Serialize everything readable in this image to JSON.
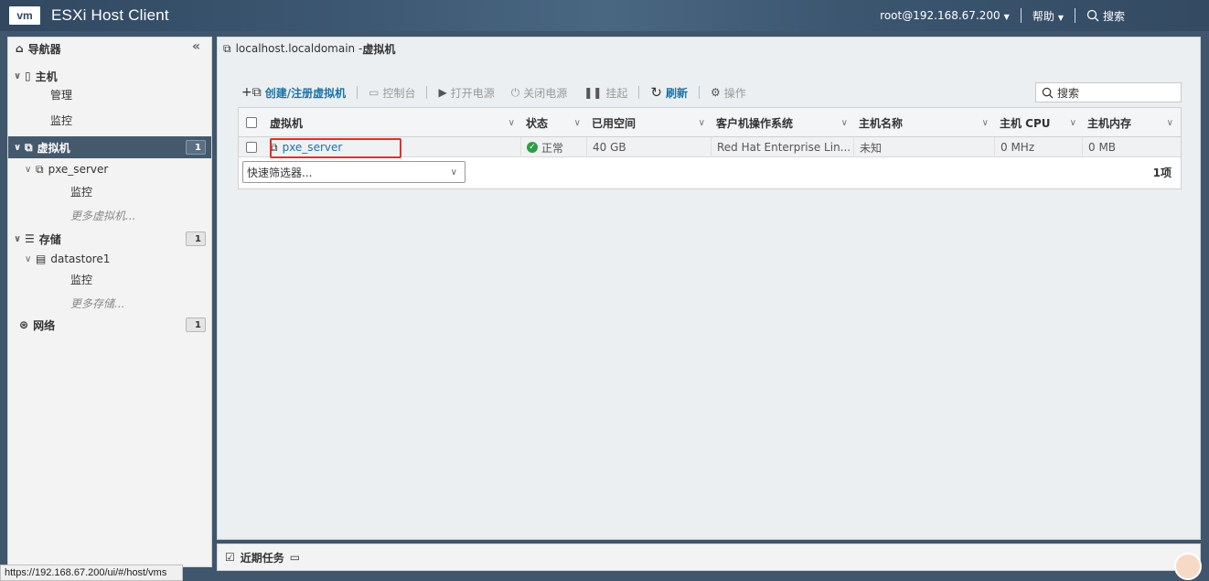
{
  "header": {
    "logo": "vm",
    "title": "ESXi Host Client",
    "user": "root@192.168.67.200",
    "help": "帮助",
    "search": "搜索"
  },
  "navigator": {
    "title": "导航器",
    "items": [
      {
        "label": "主机"
      },
      {
        "label": "管理"
      },
      {
        "label": "监控"
      },
      {
        "label": "虚拟机",
        "badge": "1"
      },
      {
        "label": "pxe_server"
      },
      {
        "label": "监控"
      },
      {
        "label": "更多虚拟机..."
      },
      {
        "label": "存储",
        "badge": "1"
      },
      {
        "label": "datastore1"
      },
      {
        "label": "监控"
      },
      {
        "label": "更多存储..."
      },
      {
        "label": "网络",
        "badge": "1"
      }
    ]
  },
  "main": {
    "breadcrumb_host": "localhost.localdomain - ",
    "breadcrumb_page": "虚拟机",
    "toolbar": {
      "create": "创建/注册虚拟机",
      "console": "控制台",
      "power_on": "打开电源",
      "power_off": "关闭电源",
      "suspend": "挂起",
      "refresh": "刷新",
      "actions": "操作",
      "search": "搜索"
    },
    "columns": [
      "虚拟机",
      "状态",
      "已用空间",
      "客户机操作系统",
      "主机名称",
      "主机 CPU",
      "主机内存"
    ],
    "rows": [
      {
        "name": "pxe_server",
        "status": "正常",
        "used": "40 GB",
        "os": "Red Hat Enterprise Lin...",
        "hostname": "未知",
        "cpu": "0 MHz",
        "memory": "0 MB"
      }
    ],
    "filter_placeholder": "快速筛选器...",
    "count": "1项"
  },
  "recent_tasks": "近期任务",
  "status_url": "https://192.168.67.200/ui/#/host/vms",
  "colors": {
    "header_bg": "#3d5873",
    "selected_bg": "#45596d",
    "link": "#1a73a8",
    "highlight": "#e03030",
    "ok": "#2e9e44"
  }
}
